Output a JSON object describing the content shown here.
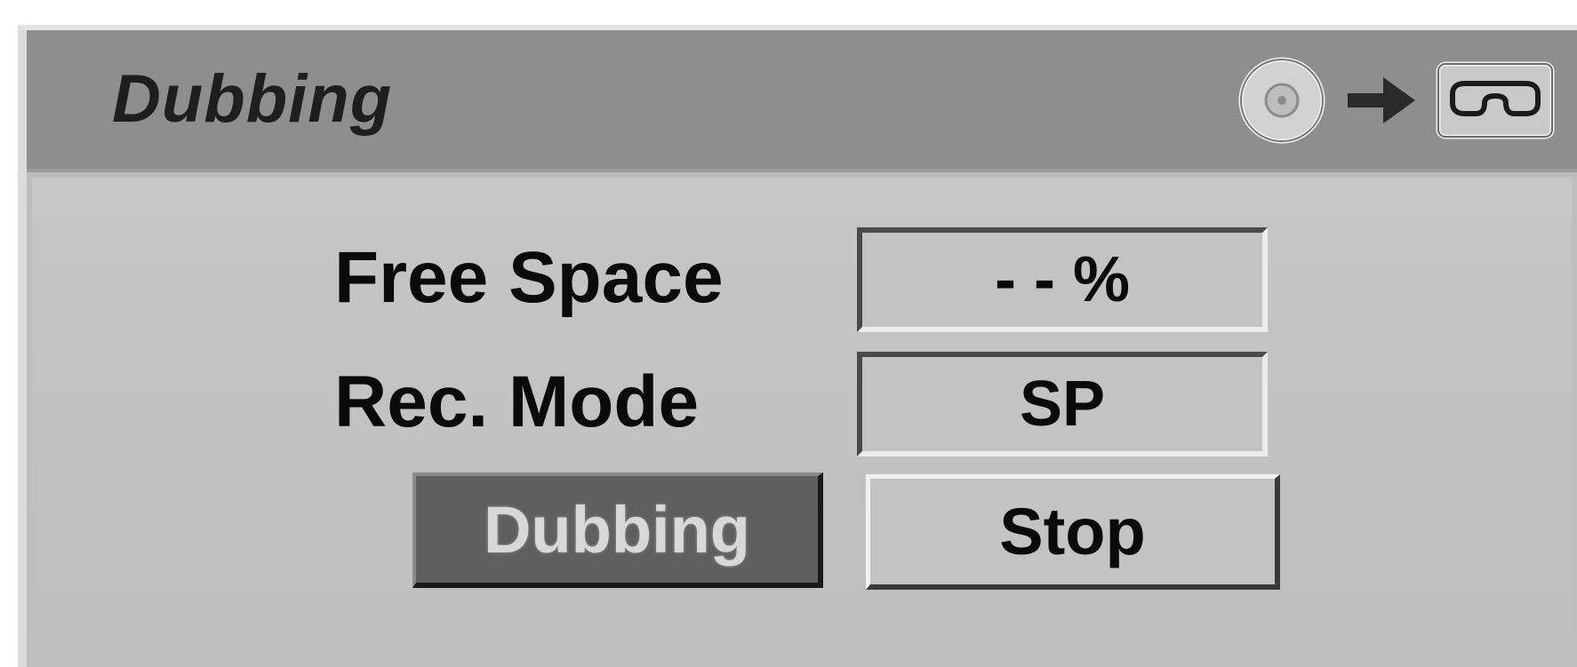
{
  "dialog": {
    "title": "Dubbing",
    "title_icons": [
      "disc-icon",
      "arrow-right-icon",
      "vhs-tape-icon"
    ]
  },
  "fields": {
    "free_space_label": "Free Space",
    "free_space_value": "- - %",
    "rec_mode_label": "Rec. Mode",
    "rec_mode_value": "SP"
  },
  "buttons": {
    "dubbing_label": "Dubbing",
    "stop_label": "Stop"
  },
  "colors": {
    "titlebar": "#8e8e8e",
    "panel": "#bdbdbd",
    "selected_button": "#5f5f5f"
  }
}
